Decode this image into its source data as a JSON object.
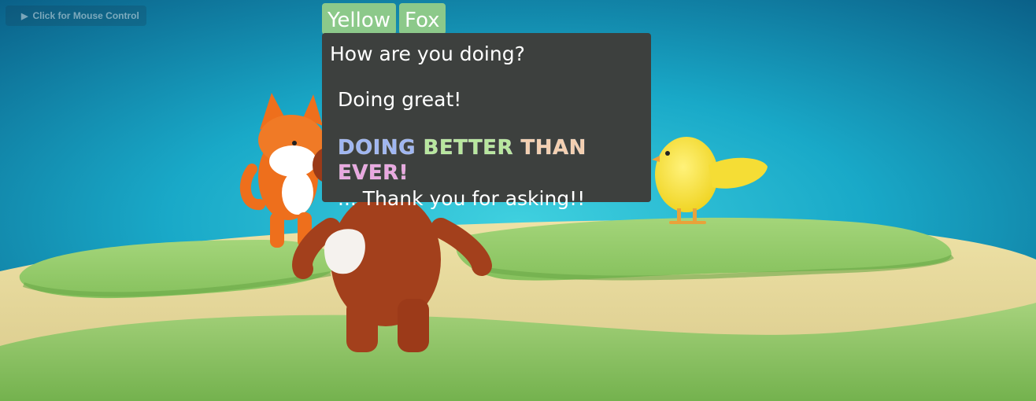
{
  "ui": {
    "mouse_control_label": "Click for Mouse Control"
  },
  "speaker_tags": [
    "Yellow",
    "Fox"
  ],
  "dialog": {
    "question": "How are you doing?",
    "choices": [
      "Doing great!",
      "DOING BETTER THAN EVER!",
      "... Thank you for asking!!"
    ]
  },
  "colors": {
    "sky_top": "#0a6d93",
    "sky_center": "#2fc6d8",
    "tag_green": "#8cc98a",
    "dialog_bg": "#3d403e",
    "rainbow": [
      "#9fb6f2",
      "#b7e79d",
      "#f4cfb0",
      "#e9a7e0",
      "#a8b8f6"
    ]
  }
}
